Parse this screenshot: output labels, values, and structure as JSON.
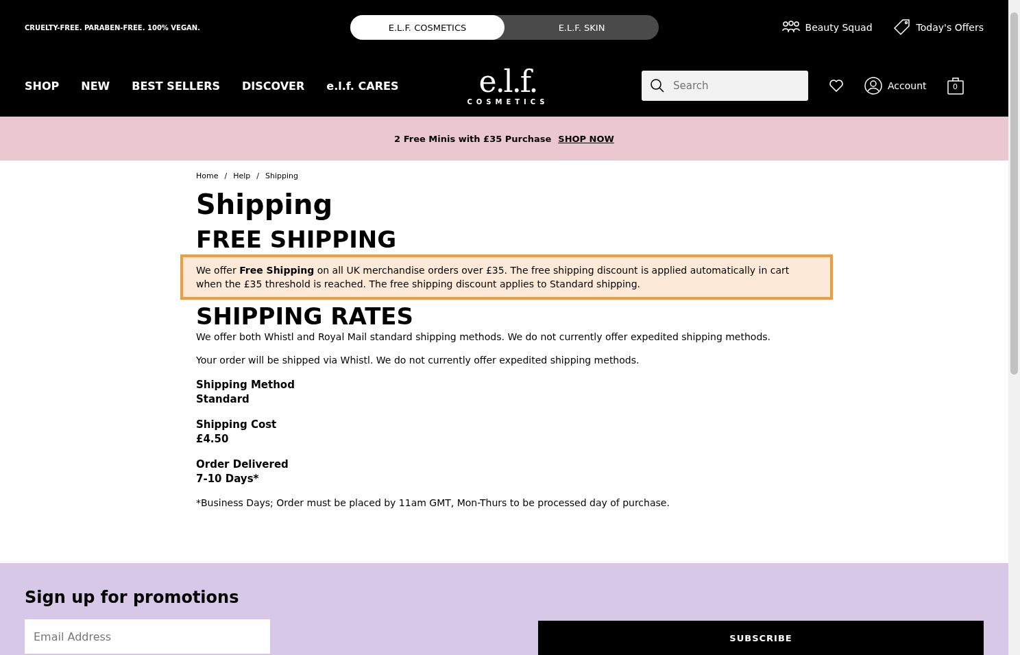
{
  "header": {
    "tagline": "CRUELTY-FREE. PARABEN-FREE. 100% VEGAN.",
    "brand_tabs": [
      {
        "label": "E.L.F. COSMETICS",
        "selected": true
      },
      {
        "label": "E.L.F. SKIN",
        "selected": false
      }
    ],
    "utility_links": [
      {
        "label": "Beauty Squad",
        "kind": "squad"
      },
      {
        "label": "Today's Offers",
        "kind": "offers"
      }
    ],
    "nav": [
      "SHOP",
      "NEW",
      "BEST SELLERS",
      "DISCOVER",
      "e.l.f. CARES"
    ],
    "logo": {
      "mark": "e.l.f.",
      "word": "COSMETICS"
    },
    "search": {
      "placeholder": "Search"
    },
    "account": "Account",
    "cart_count": "0"
  },
  "promo": {
    "text": "2 Free Minis with £35 Purchase",
    "link": "SHOP NOW"
  },
  "breadcrumb": {
    "separator": "/",
    "items": [
      "Home",
      "Help",
      "Shipping"
    ]
  },
  "title": "Shipping",
  "sections": [
    {
      "kind": "heading",
      "text": "FREE SHIPPING"
    },
    {
      "kind": "paragraph",
      "highlighted": true,
      "text": "We offer **Free Shipping** on all UK merchandise orders over £35. The free shipping discount is applied automatically in cart when the £35 threshold is reached. The free shipping discount applies to Standard shipping."
    },
    {
      "kind": "heading",
      "text": "SHIPPING RATES"
    },
    {
      "kind": "paragraph",
      "highlighted": false,
      "text": "We offer both Whistl and Royal Mail standard shipping methods. We do not currently offer expedited shipping methods."
    },
    {
      "kind": "paragraph",
      "highlighted": false,
      "text": "Your order will be shipped via Whistl. We do not currently offer expedited shipping methods."
    },
    {
      "kind": "detail",
      "label": "Shipping Method",
      "value": "Standard"
    },
    {
      "kind": "detail",
      "label": "Shipping Cost",
      "value": "£4.50"
    },
    {
      "kind": "detail",
      "label": "Order Delivered",
      "value": "7-10 Days*"
    },
    {
      "kind": "paragraph",
      "highlighted": false,
      "text": "*Business Days; Order must be placed by 11am GMT, Mon-Thurs to be processed day of purchase."
    }
  ],
  "signup": {
    "title": "Sign up for promotions",
    "email_placeholder": "Email Address",
    "button": "SUBSCRIBE"
  }
}
